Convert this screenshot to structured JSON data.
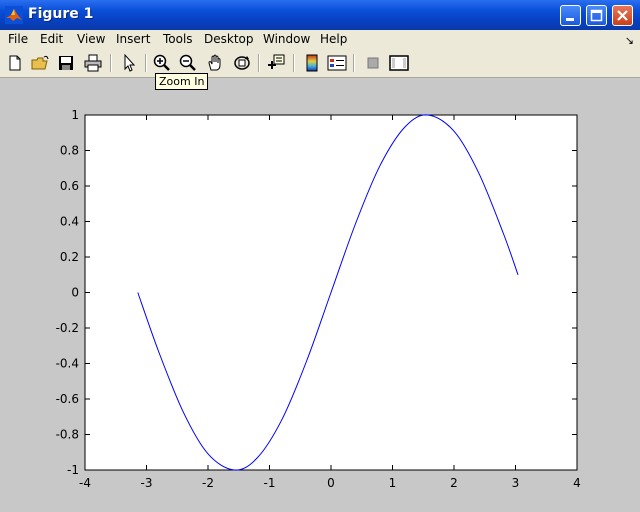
{
  "window": {
    "title": "Figure 1",
    "icon": "matlab-logo-icon",
    "controls": [
      "minimize-icon",
      "maximize-icon",
      "close-icon"
    ]
  },
  "menu": {
    "items": [
      "File",
      "Edit",
      "View",
      "Insert",
      "Tools",
      "Desktop",
      "Window",
      "Help"
    ],
    "dock_arrow": "↘"
  },
  "toolbar": {
    "buttons": [
      "new-figure-icon",
      "open-file-icon",
      "save-icon",
      "print-icon",
      "edit-plot-arrow-icon",
      "zoom-in-icon",
      "zoom-out-icon",
      "pan-hand-icon",
      "rotate-3d-icon",
      "data-cursor-icon",
      "colorbar-icon",
      "legend-icon",
      "hide-plot-tools-icon",
      "show-plot-tools-icon"
    ],
    "tooltip": "Zoom In"
  },
  "colors": {
    "title_bar": "#0a4fd8",
    "figure_bg": "#c8c8c8",
    "axes_bg": "#ffffff",
    "line": "#0000ff"
  },
  "chart_data": {
    "type": "line",
    "title": "",
    "xlabel": "",
    "ylabel": "",
    "xlim": [
      -4,
      4
    ],
    "ylim": [
      -1,
      1
    ],
    "xticks": [
      "-4",
      "-3",
      "-2",
      "-1",
      "0",
      "1",
      "2",
      "3",
      "4"
    ],
    "yticks": [
      "-1",
      "-0.8",
      "-0.6",
      "-0.4",
      "-0.2",
      "0",
      "0.2",
      "0.4",
      "0.6",
      "0.8",
      "1"
    ],
    "grid": false,
    "series": [
      {
        "function": "sin(x)",
        "color": "#0000ff",
        "x": [
          -3.1416,
          -2.8,
          -2.4,
          -2.0,
          -1.5708,
          -1.2,
          -0.8,
          -0.4,
          0.0,
          0.4,
          0.8,
          1.2,
          1.5708,
          2.0,
          2.4,
          2.8,
          3.04
        ],
        "y": [
          0.0,
          -0.335,
          -0.675,
          -0.909,
          -1.0,
          -0.932,
          -0.717,
          -0.389,
          0.0,
          0.389,
          0.717,
          0.932,
          1.0,
          0.909,
          0.675,
          0.335,
          0.1
        ]
      }
    ]
  }
}
